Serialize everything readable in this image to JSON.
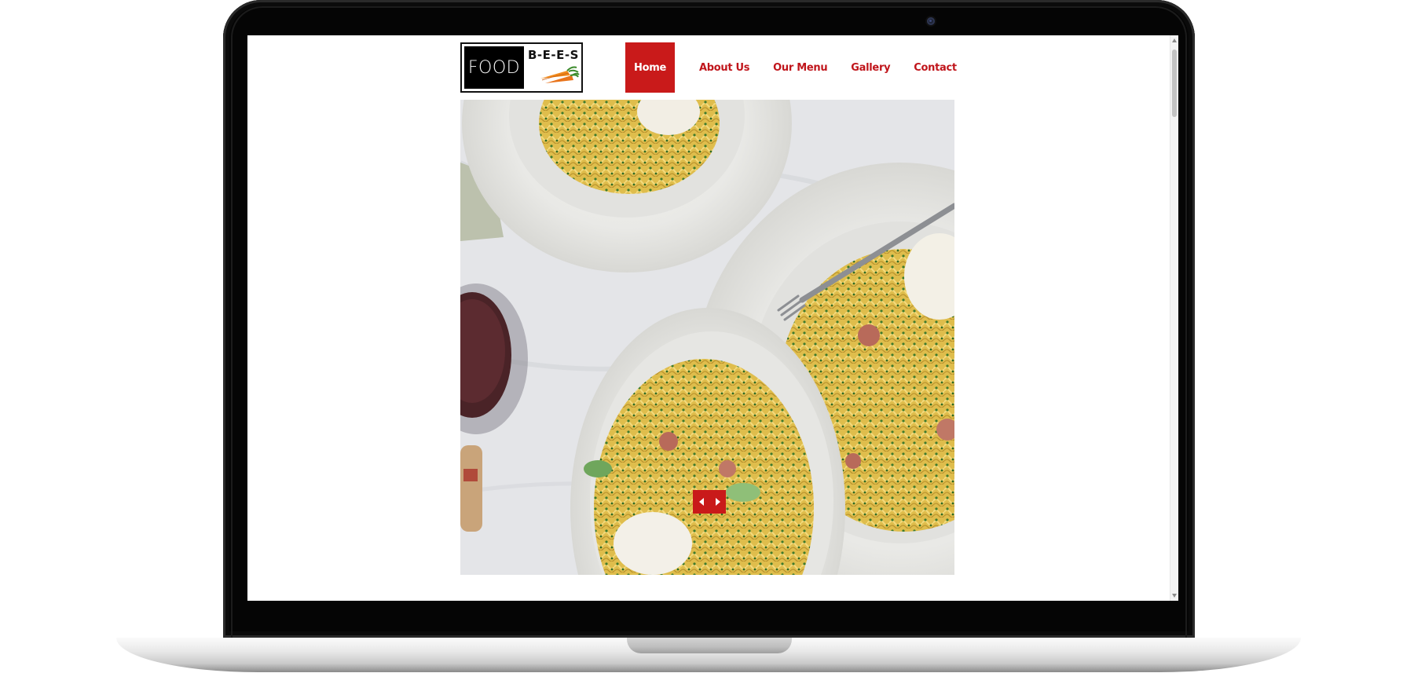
{
  "logo": {
    "word1": "FOOD",
    "word2": "B-E-E-S",
    "icon": "carrot-icon"
  },
  "nav": {
    "items": [
      {
        "label": "Home",
        "active": true
      },
      {
        "label": "About Us",
        "active": false
      },
      {
        "label": "Our Menu",
        "active": false
      },
      {
        "label": "Gallery",
        "active": false
      },
      {
        "label": "Contact",
        "active": false
      }
    ]
  },
  "slider": {
    "prev_icon": "chevron-left-icon",
    "next_icon": "chevron-right-icon"
  },
  "colors": {
    "accent": "#c91a1a",
    "nav_text": "#c0151b",
    "bezel": "#050505"
  }
}
